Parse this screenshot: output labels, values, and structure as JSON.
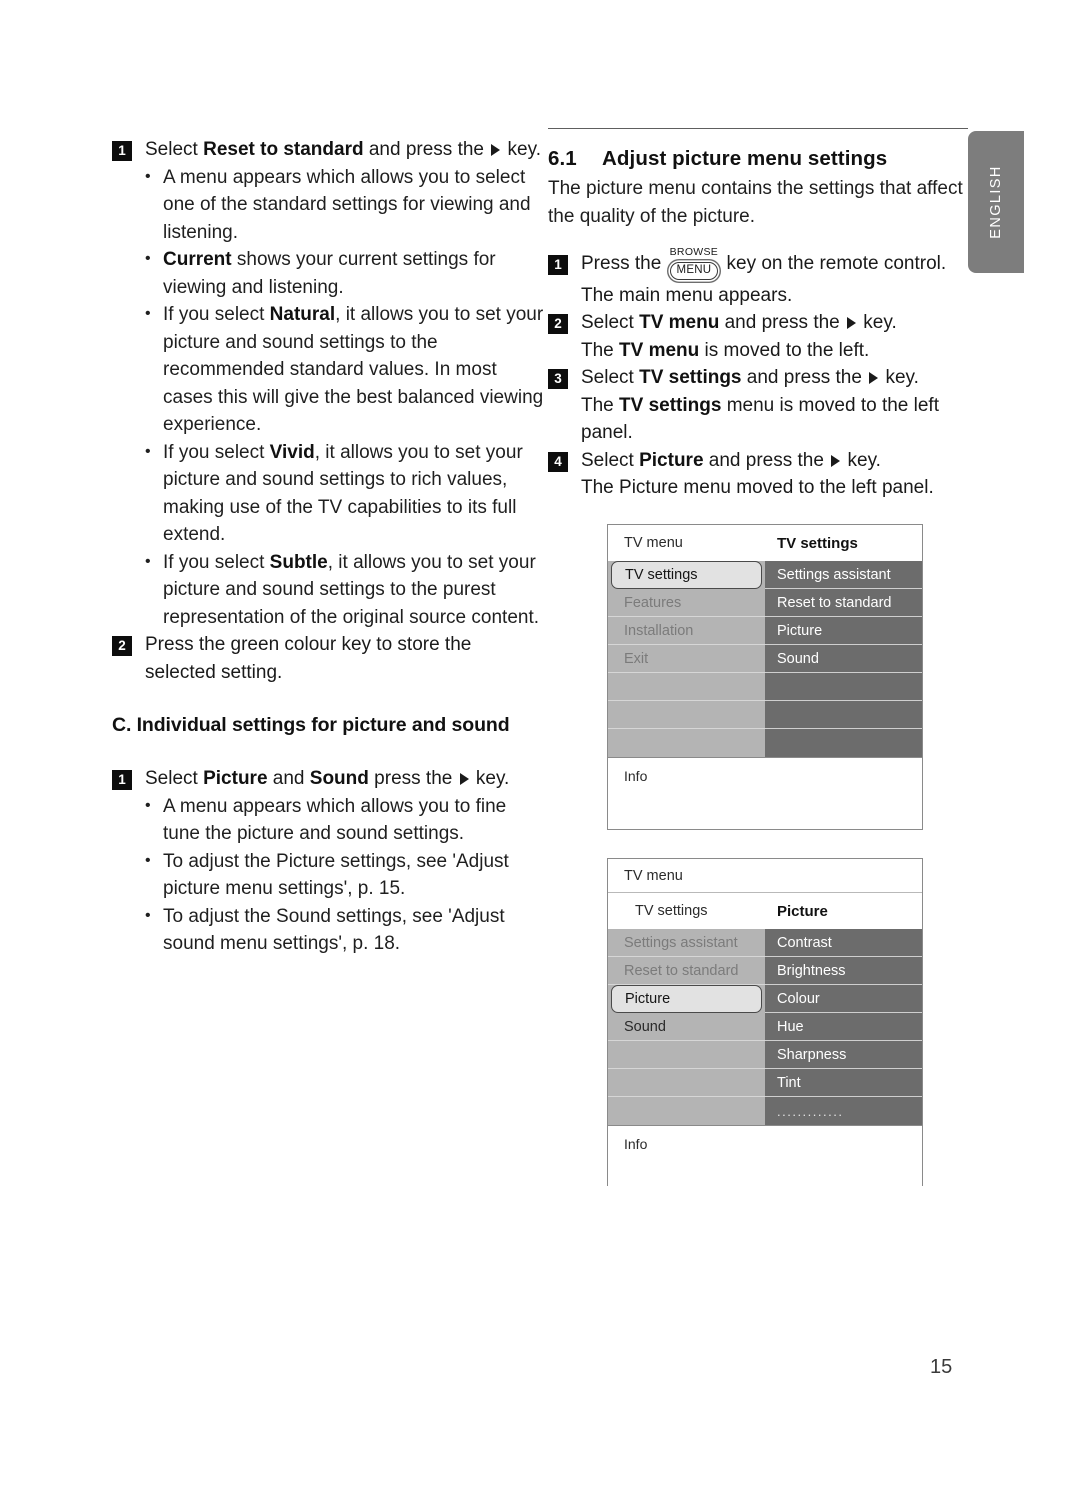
{
  "page": {
    "number": "15",
    "language_tab": "ENGLISH"
  },
  "left_column": {
    "step1": {
      "badge": "1",
      "text_a": "Select ",
      "bold_a": "Reset to standard",
      "text_b": " and press the ",
      "text_c": " key.",
      "bullets": [
        {
          "parts": [
            {
              "t": "A menu appears which allows you to select one of the standard settings for viewing and listening.",
              "b": false
            }
          ]
        },
        {
          "parts": [
            {
              "t": "Current",
              "b": true
            },
            {
              "t": " shows your current settings for viewing and listening.",
              "b": false
            }
          ]
        },
        {
          "parts": [
            {
              "t": "If you select ",
              "b": false
            },
            {
              "t": "Natural",
              "b": true
            },
            {
              "t": ", it allows you to set your picture and sound settings to the recommended standard values. In most cases this will give the best balanced viewing experience.",
              "b": false
            }
          ]
        },
        {
          "parts": [
            {
              "t": "If you select ",
              "b": false
            },
            {
              "t": "Vivid",
              "b": true
            },
            {
              "t": ", it allows you to set your picture and sound settings to rich values, making use of the TV capabilities to its full extend.",
              "b": false
            }
          ]
        },
        {
          "parts": [
            {
              "t": "If you select ",
              "b": false
            },
            {
              "t": "Subtle",
              "b": true
            },
            {
              "t": ", it allows you to set your picture and sound settings to the purest representation of the original source content.",
              "b": false
            }
          ]
        }
      ]
    },
    "step2": {
      "badge": "2",
      "text": "Press the green colour key to store the selected setting."
    },
    "heading_c": "C. Individual settings for picture and sound",
    "step3": {
      "badge": "1",
      "text_a": "Select ",
      "bold_a": "Picture",
      "text_b": " and ",
      "bold_b": "Sound",
      "text_c": " press the ",
      "text_d": " key.",
      "bullets": [
        {
          "parts": [
            {
              "t": "A menu appears which allows you to fine tune the picture and sound settings.",
              "b": false
            }
          ]
        },
        {
          "parts": [
            {
              "t": "To adjust the Picture settings, see 'Adjust picture menu settings', p. 15.",
              "b": false
            }
          ]
        },
        {
          "parts": [
            {
              "t": "To adjust the Sound settings, see 'Adjust sound menu settings', p. 18.",
              "b": false
            }
          ]
        }
      ]
    }
  },
  "right_column": {
    "section_number": "6.1",
    "section_title": "Adjust picture menu settings",
    "intro": "The picture menu contains the settings that affect the quality of the picture.",
    "steps": [
      {
        "badge": "1",
        "key_label_top": "BROWSE",
        "key_label": "MENU",
        "text_a": "Press the ",
        "text_b": " key on the remote control.",
        "text_c": "The main menu appears."
      },
      {
        "badge": "2",
        "text_a": "Select ",
        "bold_a": "TV menu",
        "text_b": " and press the ",
        "text_c": " key.",
        "line2_a": "The ",
        "line2_bold": "TV menu",
        "line2_b": " is moved to the left."
      },
      {
        "badge": "3",
        "text_a": "Select ",
        "bold_a": "TV settings",
        "text_b": " and press the ",
        "text_c": " key.",
        "line2_a": "The ",
        "line2_bold": "TV settings",
        "line2_b": " menu is moved to the left panel."
      },
      {
        "badge": "4",
        "text_a": "Select ",
        "bold_a": "Picture",
        "text_b": " and press the ",
        "text_c": " key.",
        "line2_a": "The Picture menu moved to the left panel.",
        "line2_bold": "",
        "line2_b": ""
      }
    ]
  },
  "figure1": {
    "header_left": "TV menu",
    "header_right": "TV settings",
    "left_items": [
      {
        "label": "TV settings",
        "state": "active"
      },
      {
        "label": "Features",
        "state": "normal"
      },
      {
        "label": "Installation",
        "state": "normal"
      },
      {
        "label": "Exit",
        "state": "normal"
      },
      {
        "label": "",
        "state": "empty"
      },
      {
        "label": "",
        "state": "empty"
      },
      {
        "label": "",
        "state": "empty"
      }
    ],
    "right_items": [
      {
        "label": "Settings assistant"
      },
      {
        "label": "Reset to standard"
      },
      {
        "label": "Picture"
      },
      {
        "label": "Sound"
      },
      {
        "label": ""
      },
      {
        "label": ""
      },
      {
        "label": ""
      }
    ],
    "info_label": "Info"
  },
  "figure2": {
    "header_top": "TV menu",
    "header_left": "TV settings",
    "header_right": "Picture",
    "left_items": [
      {
        "label": "Settings assistant",
        "state": "normal"
      },
      {
        "label": "Reset to standard",
        "state": "normal"
      },
      {
        "label": "Picture",
        "state": "active"
      },
      {
        "label": "Sound",
        "state": "dark"
      },
      {
        "label": "",
        "state": "empty"
      },
      {
        "label": "",
        "state": "empty"
      },
      {
        "label": "",
        "state": "empty"
      }
    ],
    "right_items": [
      {
        "label": "Contrast"
      },
      {
        "label": "Brightness"
      },
      {
        "label": "Colour"
      },
      {
        "label": "Hue"
      },
      {
        "label": "Sharpness"
      },
      {
        "label": "Tint"
      },
      {
        "label": "............."
      }
    ],
    "info_label": "Info"
  },
  "colors": {
    "menu_left_bg": "#b4b4b4",
    "menu_right_bg": "#6c6c6c",
    "active_bg": "#e2e2e2",
    "lang_tab_bg": "#7d7d7d",
    "badge_bg": "#0d0d0d"
  }
}
